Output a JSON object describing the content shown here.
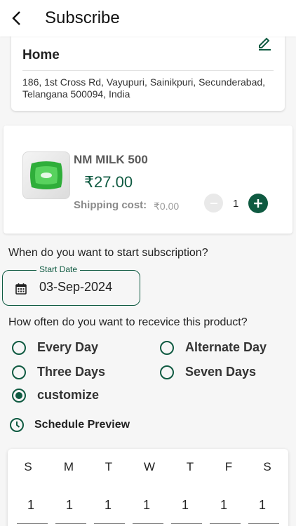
{
  "header": {
    "title": "Subscribe",
    "back_icon": "arrow-back-icon"
  },
  "address": {
    "type": "Home",
    "text": "186, 1st Cross Rd, Vayupuri, Sainikpuri, Secunderabad, Telangana 500094, India",
    "edit_icon": "edit-icon"
  },
  "product": {
    "name": "NM MILK 500",
    "price": "₹27.00",
    "shipping_label": "Shipping cost:",
    "shipping_value": "₹0.00",
    "quantity": "1"
  },
  "start": {
    "question": "When do you want to start subscription?",
    "label": "Start Date",
    "value": "03-Sep-2024"
  },
  "frequency": {
    "question": "How often do you want to recevice this product?",
    "options": [
      {
        "label": "Every Day",
        "selected": false
      },
      {
        "label": "Alternate Day",
        "selected": false
      },
      {
        "label": "Three Days",
        "selected": false
      },
      {
        "label": "Seven Days",
        "selected": false
      },
      {
        "label": "customize",
        "selected": true
      }
    ]
  },
  "preview": {
    "label": "Schedule Preview"
  },
  "calendar": {
    "days": [
      "S",
      "M",
      "T",
      "W",
      "T",
      "F",
      "S"
    ],
    "values": [
      "1",
      "1",
      "1",
      "1",
      "1",
      "1",
      "1"
    ]
  },
  "colors": {
    "accent": "#0f5a41",
    "background": "#f6f6f6"
  }
}
